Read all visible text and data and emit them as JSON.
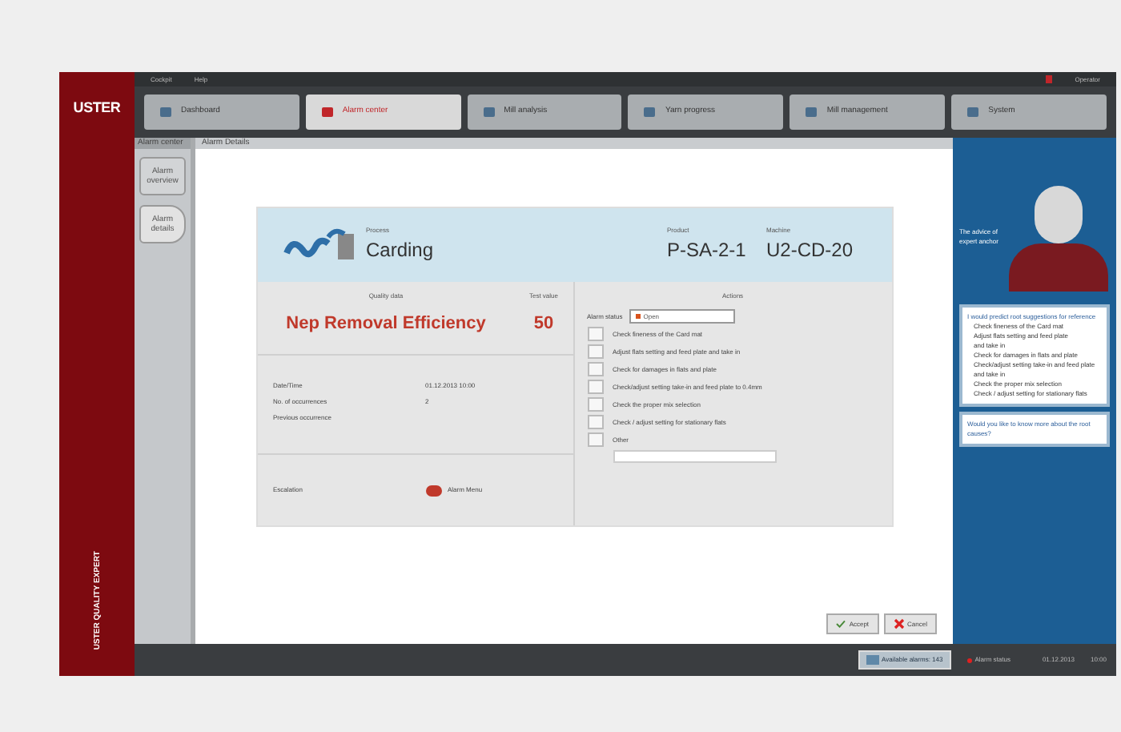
{
  "menu": [
    "Cockpit",
    "Help"
  ],
  "user": "Operator",
  "brand": {
    "logo": "USTER",
    "tagline": "USTER QUALITY EXPERT"
  },
  "tabs": [
    {
      "label": "Dashboard",
      "selected": false
    },
    {
      "label": "Alarm center",
      "selected": true
    },
    {
      "label": "Mill analysis",
      "selected": false
    },
    {
      "label": "Yarn progress",
      "selected": false
    },
    {
      "label": "Mill management",
      "selected": false
    },
    {
      "label": "System",
      "selected": false
    }
  ],
  "side_panel": {
    "title": "Alarm center",
    "items": [
      {
        "label": "Alarm overview",
        "selected": false
      },
      {
        "label": "Alarm details",
        "selected": true
      }
    ]
  },
  "content_title": "Alarm Details",
  "alarm": {
    "process_label": "Process",
    "process": "Carding",
    "product_label": "Product",
    "product": "P-SA-2-1",
    "machine_label": "Machine",
    "machine": "U2-CD-20",
    "quality_label": "Quality data",
    "quality": "Nep Removal Efficiency",
    "test_label": "Test value",
    "test_value": "50",
    "details": [
      {
        "label": "Date/Time",
        "value": "01.12.2013 10:00"
      },
      {
        "label": "No. of occurrences",
        "value": "2"
      },
      {
        "label": "Previous occurrence"
      }
    ],
    "escalation_label": "Escalation",
    "escalation_value": "Alarm Menu",
    "actions_label": "Actions",
    "status_label": "Alarm status",
    "status": "Open",
    "actions": [
      {
        "label": "Check fineness of the Card mat",
        "checked": false
      },
      {
        "label": "Adjust flats setting and feed plate and take in",
        "checked": false
      },
      {
        "label": "Check for damages in flats and plate",
        "checked": false
      },
      {
        "label": "Check/adjust setting take-in and feed plate to 0.4mm",
        "checked": false
      },
      {
        "label": "Check the proper mix selection",
        "checked": false
      },
      {
        "label": "Check / adjust setting for stationary flats",
        "checked": false
      },
      {
        "label": "Other",
        "checked": false
      }
    ]
  },
  "buttons": [
    "Accept",
    "Cancel"
  ],
  "expert": {
    "caption": "The advice of expert anchor",
    "tips": [
      {
        "title": "I would predict root suggestions for reference",
        "lines": [
          "Check fineness of the Card mat",
          "Adjust flats setting and feed plate",
          "and take in",
          "Check for damages in flats and plate",
          "Check/adjust setting take-in and feed plate",
          "and take in",
          "Check the proper mix selection",
          "Check / adjust setting for stationary flats"
        ]
      },
      {
        "title": "Would you like to know more about the root causes?"
      }
    ]
  },
  "status_bar": {
    "button": "Available alarms: 143",
    "alarm": "Alarm status",
    "date": "01.12.2013",
    "time": "10:00"
  }
}
